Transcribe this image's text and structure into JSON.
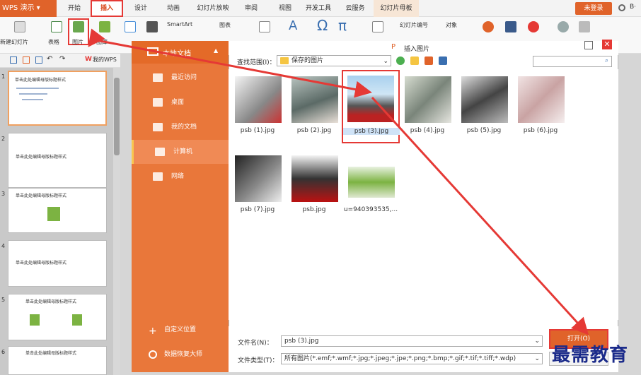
{
  "app": {
    "name": "WPS 演示",
    "login": "未登录"
  },
  "tabs": [
    {
      "label": "开始"
    },
    {
      "label": "插入"
    },
    {
      "label": "设计"
    },
    {
      "label": "动画"
    },
    {
      "label": "幻灯片放映"
    },
    {
      "label": "审阅"
    },
    {
      "label": "视图"
    },
    {
      "label": "开发工具"
    },
    {
      "label": "云服务"
    },
    {
      "label": "幻灯片母板"
    }
  ],
  "ribbon": {
    "new_slide": "新建幻灯片",
    "table": "表格",
    "picture": "图片",
    "gallery": "图库",
    "smartart": "SmartArt",
    "chart": "图表",
    "slide_number": "幻灯片编号",
    "object": "对象"
  },
  "quickbar": {
    "my_wps": "我的WPS"
  },
  "slides": [
    {
      "num": "1",
      "title": "单击此处编辑母版标题样式"
    },
    {
      "num": "2",
      "title": "单击此处编辑母版标题样式"
    },
    {
      "num": "3",
      "title": "单击此处编辑母版标题样式"
    },
    {
      "num": "4",
      "title": "单击此处编辑母版标题样式"
    },
    {
      "num": "5",
      "title": "单击此处编辑母版标题样式"
    },
    {
      "num": "6",
      "title": "单击此处编辑母版标题样式"
    }
  ],
  "nav": {
    "header": "本地文档",
    "items": [
      {
        "label": "最近访问"
      },
      {
        "label": "桌面"
      },
      {
        "label": "我的文档"
      },
      {
        "label": "计算机"
      },
      {
        "label": "网络"
      }
    ],
    "custom_location": "自定义位置",
    "data_recovery": "数据恢复大师"
  },
  "dialog": {
    "title": "插入图片",
    "look_in_label": "查找范围(I)：",
    "look_in_value": "保存的图片",
    "files": [
      {
        "name": "psb (1).jpg"
      },
      {
        "name": "psb (2).jpg"
      },
      {
        "name": "psb (3).jpg"
      },
      {
        "name": "psb (4).jpg"
      },
      {
        "name": "psb (5).jpg"
      },
      {
        "name": "psb (6).jpg"
      },
      {
        "name": "psb (7).jpg"
      },
      {
        "name": "psb.jpg"
      },
      {
        "name": "u=940393535,..."
      }
    ],
    "filename_label": "文件名(N)：",
    "filename_value": "psb (3).jpg",
    "filetype_label": "文件类型(T)：",
    "filetype_value": "所有图片(*.emf;*.wmf;*.jpg;*.jpeg;*.jpe;*.png;*.bmp;*.gif;*.tif;*.tiff;*.wdp)",
    "open_label": "打开(O)"
  },
  "watermark": "最需教育",
  "colors": {
    "accent": "#e0632a",
    "nav": "#e9773a",
    "highlight": "#e53935"
  }
}
